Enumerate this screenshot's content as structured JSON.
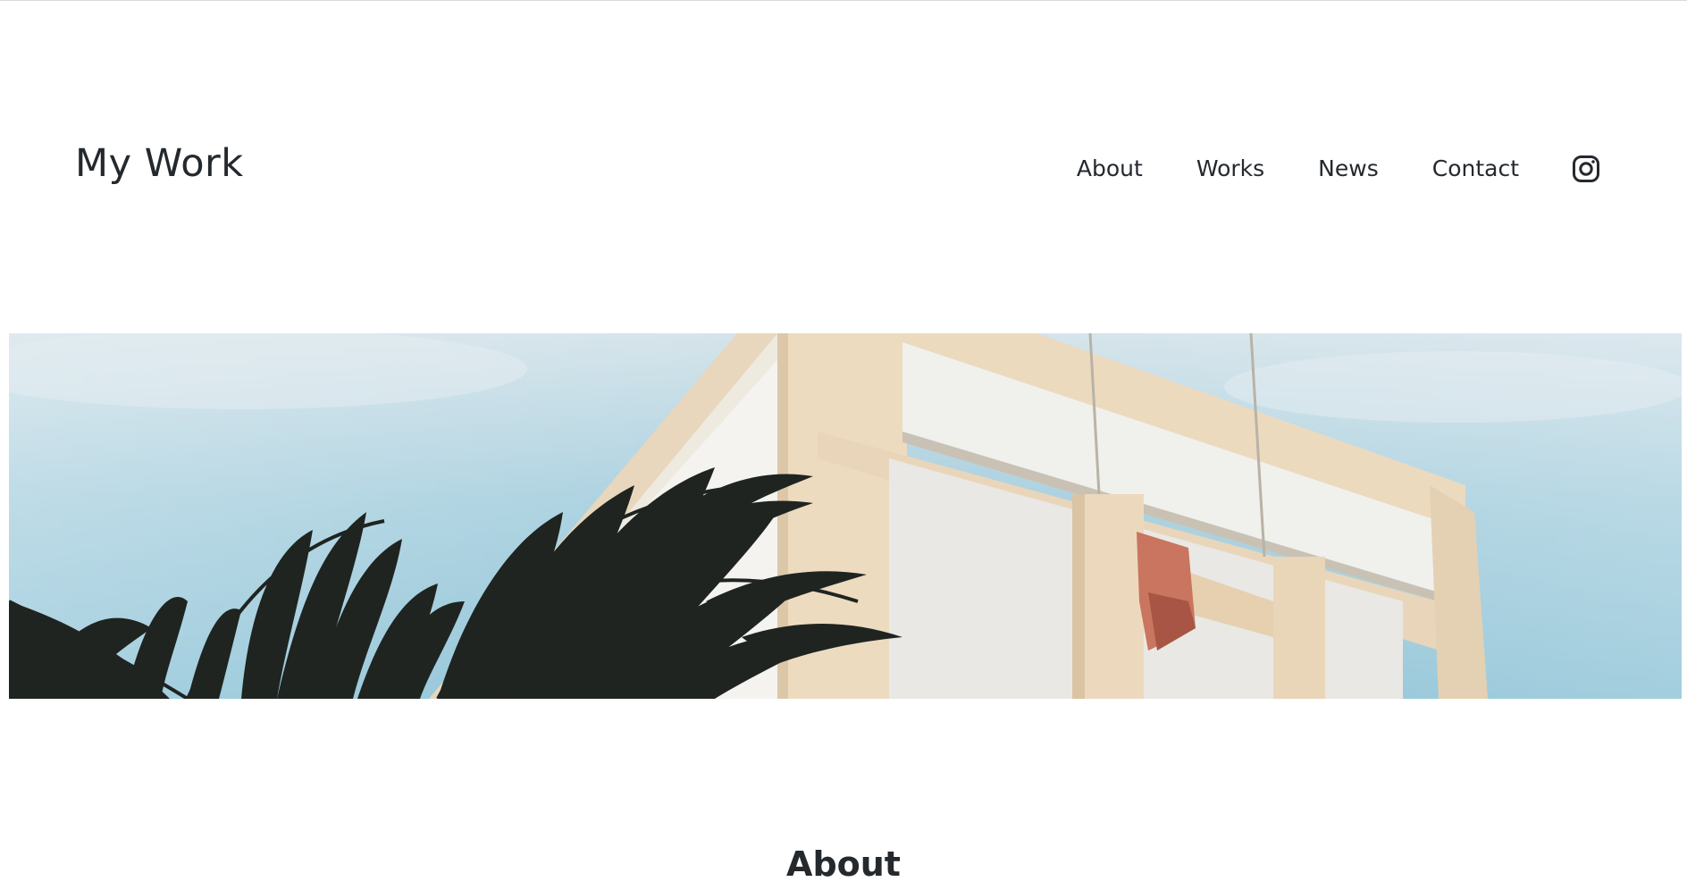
{
  "site": {
    "logo": "My Work"
  },
  "nav": {
    "items": [
      {
        "label": "About"
      },
      {
        "label": "Works"
      },
      {
        "label": "News"
      },
      {
        "label": "Contact"
      }
    ],
    "instagram_icon": "instagram-icon"
  },
  "hero": {
    "image": "building-with-palm-leaves-photo"
  },
  "sections": {
    "about_title": "About"
  },
  "colors": {
    "text": "#24292e",
    "background": "#ffffff",
    "sky": "#9fcadb",
    "building": "#ecdcc2"
  }
}
